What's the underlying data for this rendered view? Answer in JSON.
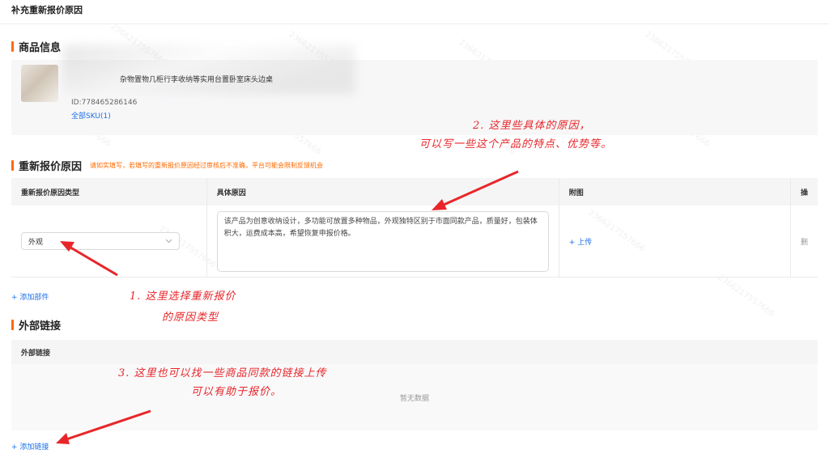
{
  "page": {
    "title": "补充重新报价原因"
  },
  "product_section": {
    "title": "商品信息",
    "product_name": "杂物置物几柜行李收纳等实用台置卧室床头边桌",
    "product_id": "ID:778465286146",
    "sku_link": "全部SKU(1)"
  },
  "reason_section": {
    "title": "重新报价原因",
    "note": "请如实填写，若填写的重新报价原因经过审核后不准确，平台可能会限制反馈机会",
    "columns": [
      "重新报价原因类型",
      "具体原因",
      "附图",
      "操"
    ],
    "row": {
      "type_value": "外观",
      "reason_text": "该产品为创意收纳设计，多功能可放置多种物品，外观独特区别于市面同款产品，质量好，包装体积大，运费成本高，希望恢复申报价格。",
      "upload_label": "+ 上传",
      "delete_label": "删"
    },
    "add_part": "+ 添加部件"
  },
  "external_section": {
    "title": "外部链接",
    "column": "外部链接",
    "empty_text": "暂无数据",
    "add_link": "+ 添加链接"
  },
  "annotations": {
    "a1_line1": "1. 这里选择重新报价",
    "a1_line2": "的原因类型",
    "a2_line1": "2. 这里些具体的原因，",
    "a2_line2": "可以写一些这个产品的特点、优势等。",
    "a3_line1": "3. 这里也可以找一些商品同款的链接上传",
    "a3_line2": "可以有助于报价。"
  },
  "watermark_text": "2366217557666",
  "colors": {
    "accent": "#ff6a00",
    "link": "#1b6fe8",
    "annotation": "#e8262a"
  }
}
